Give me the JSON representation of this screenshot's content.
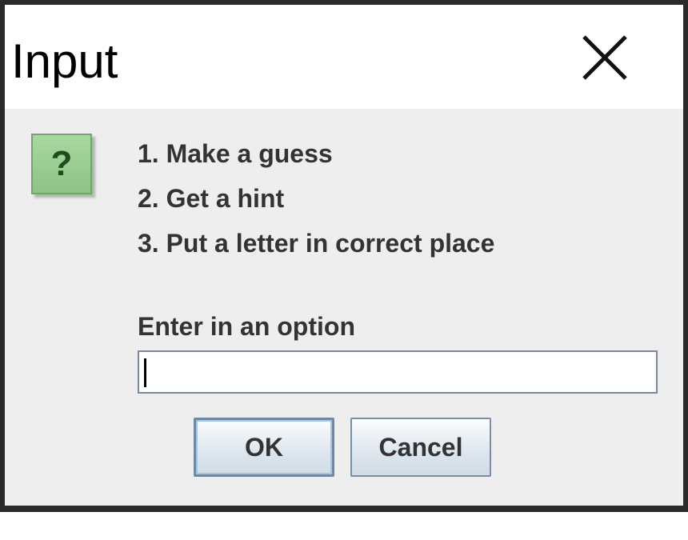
{
  "dialog": {
    "title": "Input",
    "close_icon": "close-icon",
    "question_icon": {
      "name": "question-icon",
      "glyph": "?"
    },
    "message_lines": [
      "1. Make a guess",
      "2. Get a hint",
      "3. Put a letter in correct place"
    ],
    "prompt_label": "Enter in an option",
    "input_value": "",
    "ok_label": "OK",
    "cancel_label": "Cancel"
  },
  "colors": {
    "dialog_background": "#eeeeee",
    "titlebar_background": "#ffffff",
    "icon_green": "#a8d8a0",
    "text": "#333333"
  }
}
